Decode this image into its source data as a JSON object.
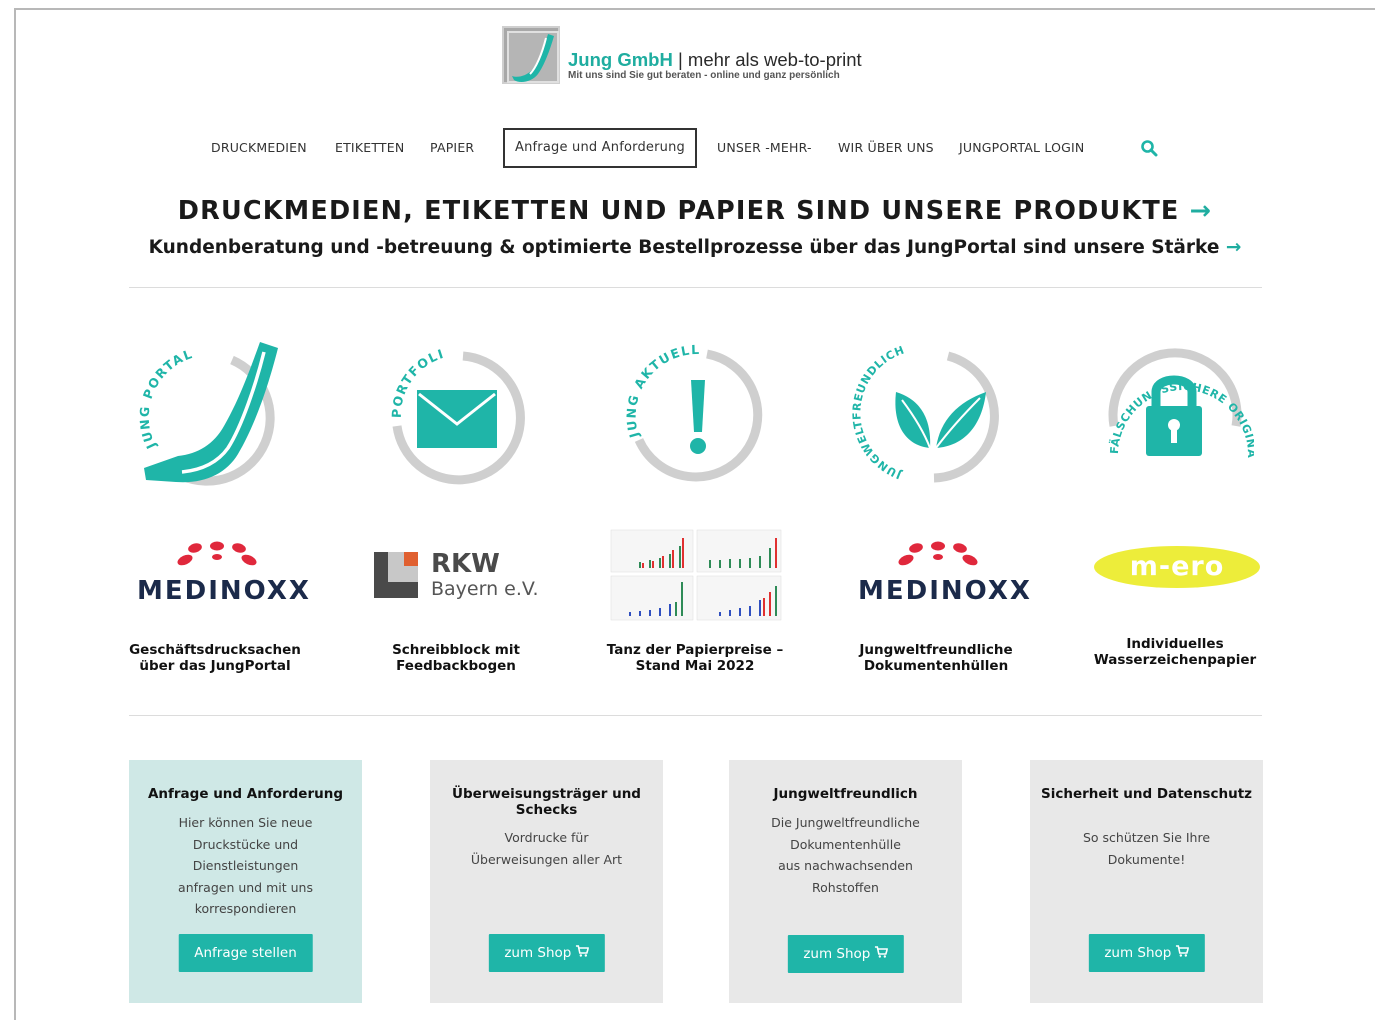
{
  "header": {
    "brand": "Jung GmbH",
    "tagline": "| mehr als web-to-print",
    "subtagline": "Mit uns sind Sie gut beraten - online und ganz persönlich"
  },
  "nav": {
    "items": [
      "DRUCKMEDIEN",
      "ETIKETTEN",
      "PAPIER",
      "Anfrage und Anforderung",
      "UNSER -MEHR-",
      "WIR ÜBER UNS",
      "JUNGPORTAL LOGIN"
    ]
  },
  "hero": {
    "headline": "DRUCKMEDIEN, ETIKETTEN UND PAPIER SIND UNSERE PRODUKTE",
    "subline": "Kundenberatung und -betreuung & optimierte Bestellprozesse über das JungPortal sind unsere Stärke",
    "arrow": "→"
  },
  "icons": [
    {
      "label": "JUNG PORTAL",
      "icon": "j-logo-icon"
    },
    {
      "label": "PORTFOLIO",
      "icon": "envelope-icon"
    },
    {
      "label": "JUNG AKTUELL",
      "icon": "exclamation-icon"
    },
    {
      "label": "JUNGWELTFREUNDLICH",
      "icon": "leaves-icon"
    },
    {
      "label": "FÄLSCHUNGSSICHERE ORIGINALE",
      "icon": "padlock-icon"
    }
  ],
  "references": {
    "medinoxx": "MEDINOXX",
    "rkw_top": "RKW",
    "rkw_bottom": "Bayern e.V.",
    "mero": "m-ero"
  },
  "items": [
    {
      "title_line1": "Geschäftsdrucksachen",
      "title_line2": "über das JungPortal"
    },
    {
      "title_line1": "Schreibblock mit",
      "title_line2": "Feedbackbogen"
    },
    {
      "title_line1": "Tanz der Papierpreise –",
      "title_line2": "Stand Mai 2022"
    },
    {
      "title_line1": "Jungweltfreundliche",
      "title_line2": "Dokumentenhüllen"
    },
    {
      "title_line1": "Individuelles",
      "title_line2": "Wasserzeichenpapier"
    }
  ],
  "cards": [
    {
      "title": "Anfrage und Anforderung",
      "lines": [
        "Hier können Sie neue",
        "Druckstücke und",
        "Dienstleistungen",
        "anfragen und mit uns",
        "korrespondieren"
      ],
      "button": "Anfrage stellen"
    },
    {
      "title": "Überweisungsträger und Schecks",
      "lines": [
        "Vordrucke für",
        "Überweisungen aller Art"
      ],
      "button": "zum Shop"
    },
    {
      "title": "Jungweltfreundlich",
      "lines": [
        "Die Jungweltfreundliche",
        "Dokumentenhülle",
        "aus nachwachsenden",
        "Rohstoffen"
      ],
      "button": "zum Shop"
    },
    {
      "title": "Sicherheit und Datenschutz",
      "lines": [
        "So schützen Sie Ihre",
        "Dokumente!"
      ],
      "button": "zum Shop"
    }
  ],
  "colors": {
    "accent": "#1fb5a8",
    "ring": "#cfcfcf",
    "medinoxx_red": "#e0283c",
    "medinoxx_navy": "#1b2a4a",
    "mero_yellow": "#eded3a"
  }
}
